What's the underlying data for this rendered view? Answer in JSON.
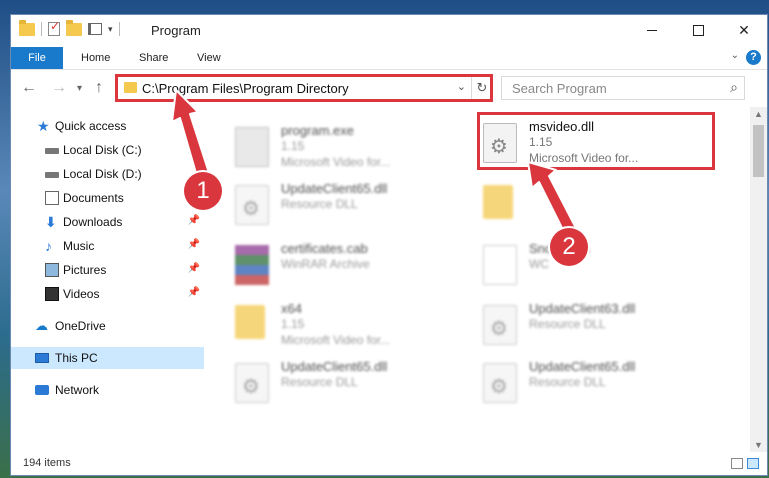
{
  "window": {
    "title": "Program"
  },
  "ribbon": {
    "file": "File",
    "home": "Home",
    "share": "Share",
    "view": "View",
    "help": "?"
  },
  "nav": {
    "address": "C:\\Program Files\\Program Directory",
    "search_placeholder": "Search Program"
  },
  "sidebar": {
    "items": [
      {
        "label": "Quick access",
        "icon": "star-icon"
      },
      {
        "label": "Local Disk (C:)",
        "icon": "disk-icon"
      },
      {
        "label": "Local Disk (D:)",
        "icon": "disk-icon"
      },
      {
        "label": "Documents",
        "icon": "documents-icon"
      },
      {
        "label": "Downloads",
        "icon": "download-icon"
      },
      {
        "label": "Music",
        "icon": "music-icon"
      },
      {
        "label": "Pictures",
        "icon": "pictures-icon"
      },
      {
        "label": "Videos",
        "icon": "videos-icon"
      },
      {
        "label": "OneDrive",
        "icon": "cloud-icon"
      },
      {
        "label": "This PC",
        "icon": "computer-icon"
      },
      {
        "label": "Network",
        "icon": "network-icon"
      }
    ]
  },
  "files": [
    {
      "name": "program.exe",
      "line2": "1.15",
      "line3": "Microsoft Video for..."
    },
    {
      "name": "msvideo.dll",
      "line2": "1.15",
      "line3": "Microsoft Video for..."
    },
    {
      "name": "UpdateClient65.dll",
      "line2": "Resource DLL",
      "line3": ""
    },
    {
      "name": "",
      "line2": "",
      "line3": ""
    },
    {
      "name": "certificates.cab",
      "line2": "WinRAR Archive",
      "line3": ""
    },
    {
      "name": "Sno...wcm",
      "line2": "WC",
      "line3": ""
    },
    {
      "name": "x64",
      "line2": "1.15",
      "line3": "Microsoft Video for..."
    },
    {
      "name": "UpdateClient63.dll",
      "line2": "Resource DLL",
      "line3": ""
    },
    {
      "name": "UpdateClient65.dll",
      "line2": "Resource DLL",
      "line3": ""
    },
    {
      "name": "UpdateClient65.dll",
      "line2": "Resource DLL",
      "line3": ""
    }
  ],
  "status": {
    "count": "194 items"
  },
  "callouts": {
    "one": "1",
    "two": "2"
  },
  "colors": {
    "accent": "#1979ca",
    "highlight": "#d9363e",
    "selected": "#cce8ff"
  }
}
